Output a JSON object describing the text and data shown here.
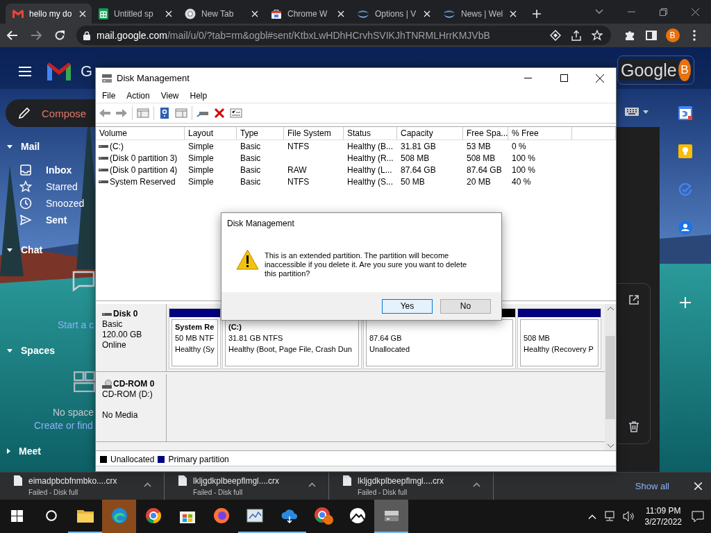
{
  "browser": {
    "tabs": [
      {
        "title": "hello my do",
        "selected": true
      },
      {
        "title": "Untitled sp",
        "selected": false
      },
      {
        "title": "New Tab",
        "selected": false
      },
      {
        "title": "Chrome W",
        "selected": false
      },
      {
        "title": "Options | V",
        "selected": false
      },
      {
        "title": "News | Wel",
        "selected": false
      }
    ],
    "url_host": "mail.google.com",
    "url_path": "/mail/u/0/?tab=rm&ogbl#sent/KtbxLwHDhHCrvhSVIKJhTNRMLHrrKMJVbB",
    "profile": "B"
  },
  "gmail": {
    "logo": "G",
    "compose": "Compose",
    "account": "Google",
    "avatar": "B",
    "sections": [
      {
        "kind": "mail",
        "title": "Mail",
        "expanded": true,
        "items": [
          {
            "label": "Inbox",
            "unread": true
          },
          {
            "label": "Starred",
            "unread": false
          },
          {
            "label": "Snoozed",
            "unread": false
          },
          {
            "label": "Sent",
            "unread": true
          }
        ]
      },
      {
        "kind": "chat",
        "title": "Chat",
        "expanded": true,
        "links": [
          "Start a c"
        ]
      },
      {
        "kind": "spaces",
        "title": "Spaces",
        "expanded": true,
        "note": "No space",
        "links": [
          "Create or find"
        ]
      },
      {
        "kind": "meet",
        "title": "Meet",
        "expanded": false
      }
    ]
  },
  "disk_management": {
    "title": "Disk Management",
    "menu": [
      "File",
      "Action",
      "View",
      "Help"
    ],
    "columns": [
      "Volume",
      "Layout",
      "Type",
      "File System",
      "Status",
      "Capacity",
      "Free Spa...",
      "% Free"
    ],
    "rows": [
      {
        "volume": "(C:)",
        "layout": "Simple",
        "type": "Basic",
        "file_system": "NTFS",
        "status": "Healthy (B...",
        "capacity": "31.81 GB",
        "free_space": "53 MB",
        "percent_free": "0 %"
      },
      {
        "volume": "(Disk 0 partition 3)",
        "layout": "Simple",
        "type": "Basic",
        "status": "Healthy (R...",
        "capacity": "508 MB",
        "free_space": "508 MB",
        "percent_free": "100 %"
      },
      {
        "volume": "(Disk 0 partition 4)",
        "layout": "Simple",
        "type": "Basic",
        "file_system": "RAW",
        "status": "Healthy (L...",
        "capacity": "87.64 GB",
        "free_space": "87.64 GB",
        "percent_free": "100 %"
      },
      {
        "volume": "System Reserved",
        "layout": "Simple",
        "type": "Basic",
        "file_system": "NTFS",
        "status": "Healthy (S...",
        "capacity": "50 MB",
        "free_space": "20 MB",
        "percent_free": "40 %"
      }
    ],
    "disks": [
      {
        "kind": "disk",
        "name": "Disk 0",
        "details": [
          "Basic",
          "120.00 GB",
          "Online"
        ],
        "partitions": [
          {
            "color": "#000080",
            "name": "System Re",
            "lines": [
              "50 MB NTF",
              "Healthy (Sy"
            ]
          },
          {
            "name": "(C:)",
            "lines": [
              "31.81 GB NTFS",
              "Healthy (Boot, Page File, Crash Dun"
            ]
          },
          {
            "color": "#000000",
            "lines": [
              "87.64 GB",
              "Unallocated"
            ]
          },
          {
            "color": "#000080",
            "lines": [
              "508 MB",
              "Healthy (Recovery P"
            ]
          }
        ]
      },
      {
        "kind": "cdrom",
        "name": "CD-ROM 0",
        "details": [
          "CD-ROM (D:)"
        ],
        "status": "No Media"
      }
    ],
    "legend": [
      {
        "label": "Unallocated",
        "color": "#000000"
      },
      {
        "label": "Primary partition",
        "color": "#000080"
      }
    ]
  },
  "dialog": {
    "title": "Disk Management",
    "message": "This is an extended partition. The partition will become inaccessible if you delete it. Are you sure you want to delete this partition?",
    "buttons": [
      {
        "label": "Yes",
        "default": true
      },
      {
        "label": "No",
        "default": false
      }
    ]
  },
  "downloads": {
    "items": [
      {
        "name": "eimadpbcbfnmbko....crx",
        "status": "Failed - Disk full"
      },
      {
        "name": "lkljgdkplbeepflmgl....crx",
        "status": "Failed - Disk full"
      },
      {
        "name": "lkljgdkplbeepflmgl....crx",
        "status": "Failed - Disk full"
      }
    ],
    "show_all": "Show all"
  },
  "taskbar": {
    "apps": [
      {
        "open": true,
        "active": false
      },
      {
        "open": false,
        "active": true
      },
      {
        "open": false,
        "active": false
      },
      {
        "open": false,
        "active": false
      },
      {
        "open": false,
        "active": false
      },
      {
        "open": true,
        "active": false
      },
      {
        "open": true,
        "active": false
      },
      {
        "open": false,
        "active": false
      },
      {
        "open": false,
        "active": false
      },
      {
        "open": true,
        "active": true
      }
    ],
    "time": "11:09 PM",
    "date": "3/27/2022"
  }
}
